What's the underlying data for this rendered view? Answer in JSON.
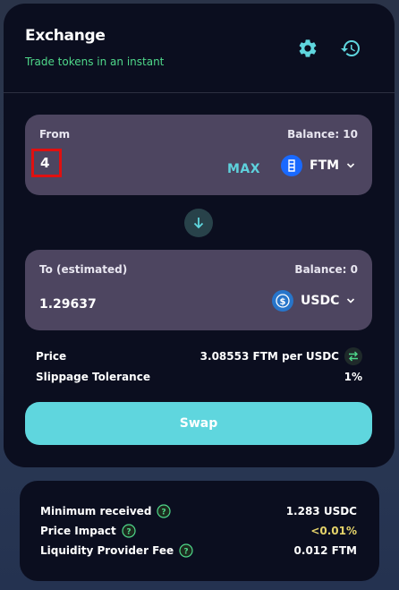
{
  "header": {
    "title": "Exchange",
    "subtitle": "Trade tokens in an instant",
    "settings_icon": "gear-icon",
    "history_icon": "history-icon"
  },
  "from": {
    "label": "From",
    "balance": "Balance: 10",
    "amount": "4",
    "max_label": "MAX",
    "token": "FTM"
  },
  "to": {
    "label": "To (estimated)",
    "balance": "Balance: 0",
    "amount": "1.29637",
    "token": "USDC"
  },
  "price": {
    "label": "Price",
    "value": "3.08553 FTM per USDC"
  },
  "slippage": {
    "label": "Slippage Tolerance",
    "value": "1%"
  },
  "swap_label": "Swap",
  "details": {
    "min_received_label": "Minimum received",
    "min_received_value": "1.283 USDC",
    "price_impact_label": "Price Impact",
    "price_impact_value": "<0.01%",
    "lp_fee_label": "Liquidity Provider Fee",
    "lp_fee_value": "0.012 FTM"
  },
  "colors": {
    "accent": "#5fd6de",
    "subtitle": "#4fd88a",
    "impact": "#e5d36a",
    "panel": "#4d4560",
    "card": "#0b0e1f"
  }
}
